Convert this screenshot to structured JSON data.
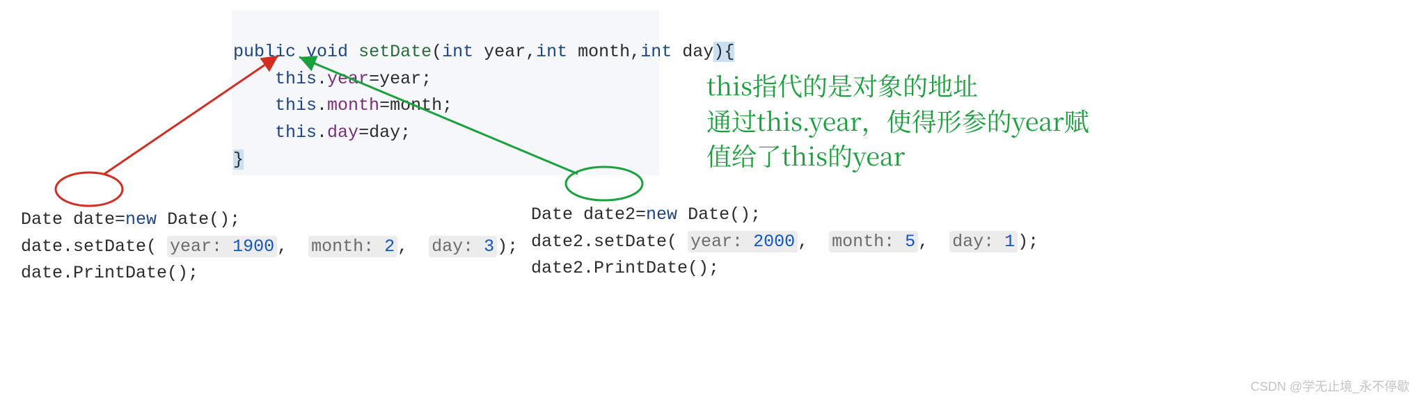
{
  "top_code": {
    "sig_public": "public",
    "sig_void": "void",
    "sig_name": "setDate",
    "sig_open": "(",
    "sig_p1t": "int",
    "sig_p1n": " year,",
    "sig_p2t": "int",
    "sig_p2n": " month,",
    "sig_p3t": "int",
    "sig_p3n": " day",
    "sig_close": "){",
    "l1a": "this",
    "l1b": ".",
    "l1c": "year",
    "l1d": "=year;",
    "l2a": "this",
    "l2b": ".",
    "l2c": "month",
    "l2d": "=month;",
    "l3a": "this",
    "l3b": ".",
    "l3c": "day",
    "l3d": "=day;",
    "close": "}"
  },
  "left_code": {
    "l1a": "Date ",
    "l1b": "date",
    "l1c": "=",
    "l1d": "new",
    "l1e": " Date();",
    "l2a": "date.setDate( ",
    "hint_year_lbl": "year:",
    "hint_year_val": " 1900",
    "comma1": ",  ",
    "hint_month_lbl": "month:",
    "hint_month_val": " 2",
    "comma2": ",  ",
    "hint_day_lbl": "day:",
    "hint_day_val": " 3",
    "l2end": ");",
    "l3": "date.PrintDate();"
  },
  "right_code": {
    "l1a": "Date ",
    "l1b": "date2",
    "l1c": "=",
    "l1d": "new",
    "l1e": " Date();",
    "l2a": "date2.setDate( ",
    "hint_year_lbl": "year:",
    "hint_year_val": " 2000",
    "comma1": ",  ",
    "hint_month_lbl": "month:",
    "hint_month_val": " 5",
    "comma2": ",  ",
    "hint_day_lbl": "day:",
    "hint_day_val": " 1",
    "l2end": ");",
    "l3": "date2.PrintDate();"
  },
  "annotation": {
    "line1": "this指代的是对象的地址",
    "line2": "通过this.year，使得形参的year赋",
    "line3": "值给了this的year"
  },
  "watermark": "CSDN @学无止境_永不停歇"
}
